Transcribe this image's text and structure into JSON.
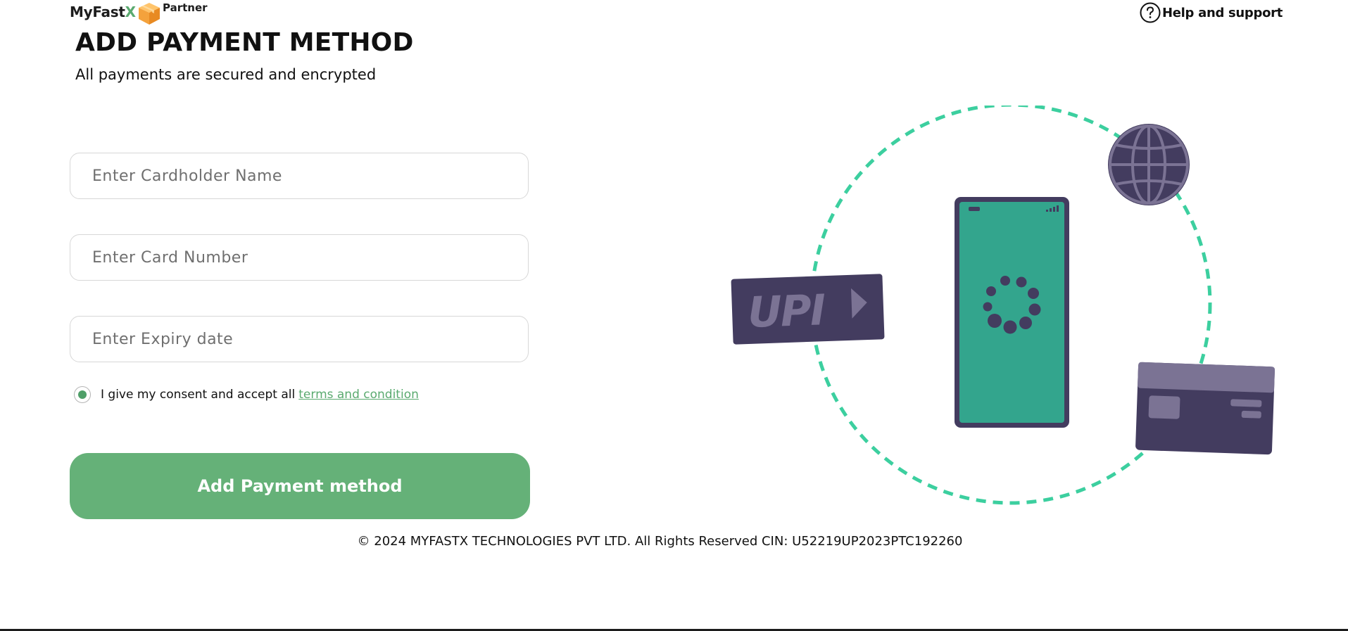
{
  "header": {
    "logo_text": "MyFast",
    "logo_accent": "X",
    "logo_badge": "Partner",
    "help_label": "Help and support"
  },
  "form": {
    "title": "ADD PAYMENT METHOD",
    "subtitle": "All payments are secured and encrypted",
    "cardholder_placeholder": "Enter Cardholder Name",
    "card_number_placeholder": "Enter Card Number",
    "expiry_placeholder": "Enter Expiry date",
    "consent_text": "I give my consent and accept all",
    "consent_link": "terms and condition",
    "consent_checked": true,
    "submit_label": "Add Payment method"
  },
  "illustration": {
    "upi_text": "UPI"
  },
  "footer": {
    "copyright": "© 2024 MYFASTX TECHNOLOGIES PVT LTD. All Rights Reserved CIN: U52219UP2023PTC192260"
  },
  "colors": {
    "accent": "#65b178",
    "link": "#5aaa6f",
    "dark_navy": "#433c5f",
    "phone_teal": "#33a58d",
    "orbit": "#3ccf9f"
  },
  "icons": [
    "box-icon",
    "help-icon",
    "globe-icon",
    "phone-icon",
    "loading-icon",
    "credit-card-icon",
    "upi-card-icon"
  ]
}
